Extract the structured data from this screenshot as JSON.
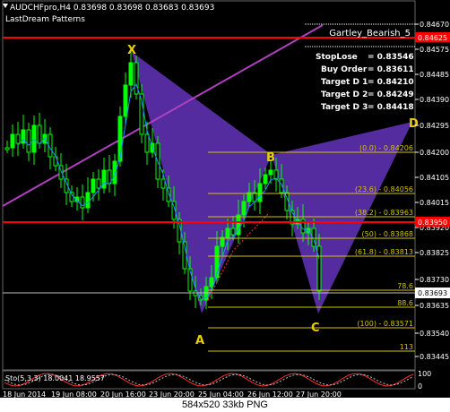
{
  "window": {
    "title": "AUDCHFpro,H4  0.83698 0.83698 0.83683 0.83693",
    "indicator": "LastDream Patterns"
  },
  "pattern": {
    "name": "Gartley_Bearish_5",
    "points": {
      "X": "X",
      "A": "A",
      "B": "B",
      "C": "C",
      "D": "D"
    },
    "stoploss_label": "StopLose",
    "stoploss": "= 0.83546",
    "buy_label": "Buy Order",
    "buy": "= 0.83611",
    "t1_label": "Target D 1",
    "t1": "= 0.84210",
    "t2_label": "Target D 2",
    "t2": "= 0.84249",
    "t3_label": "Target D 3",
    "t3": "= 0.84418"
  },
  "fib_levels": [
    {
      "label": "(0.0) - 0.84206"
    },
    {
      "label": "(23.6) - 0.84056"
    },
    {
      "label": "(38.2) - 0.83963"
    },
    {
      "label": "(50) - 0.83868"
    },
    {
      "label": "(61.8) - 0.83813"
    },
    {
      "label": "78.6"
    },
    {
      "label": "88.6"
    },
    {
      "label": "(100) - 0.83571"
    },
    {
      "label": "113"
    }
  ],
  "price_axis": {
    "ticks": [
      "0.84670",
      "0.84575",
      "0.84485",
      "0.84390",
      "0.84295",
      "0.84200",
      "0.84105",
      "0.84015",
      "0.83920",
      "0.83825",
      "0.83730",
      "0.83635",
      "0.83540",
      "0.83445"
    ],
    "red_tag": "0.84625",
    "red_tag2": "0.83950",
    "current": "0.83693"
  },
  "time_axis": [
    "18 Jun 2014",
    "19 Jun 08:00",
    "20 Jun 16:00",
    "23 Jun 20:00",
    "25 Jun 04:00",
    "26 Jun 12:00",
    "27 Jun 20:00"
  ],
  "stochastic": {
    "label": "Sto(5,3,3) 18.0041 18.9557",
    "levels": [
      "100",
      "0"
    ]
  },
  "caption": "584x520  33kb  PNG",
  "colors": {
    "bull": "#00ff00",
    "bear": "#00ff00",
    "pattern_fill": "#5a2ea8",
    "red_line": "#ff0000",
    "fib": "#d4c200",
    "ma": "#1e90ff",
    "trend": "#b040c0"
  }
}
